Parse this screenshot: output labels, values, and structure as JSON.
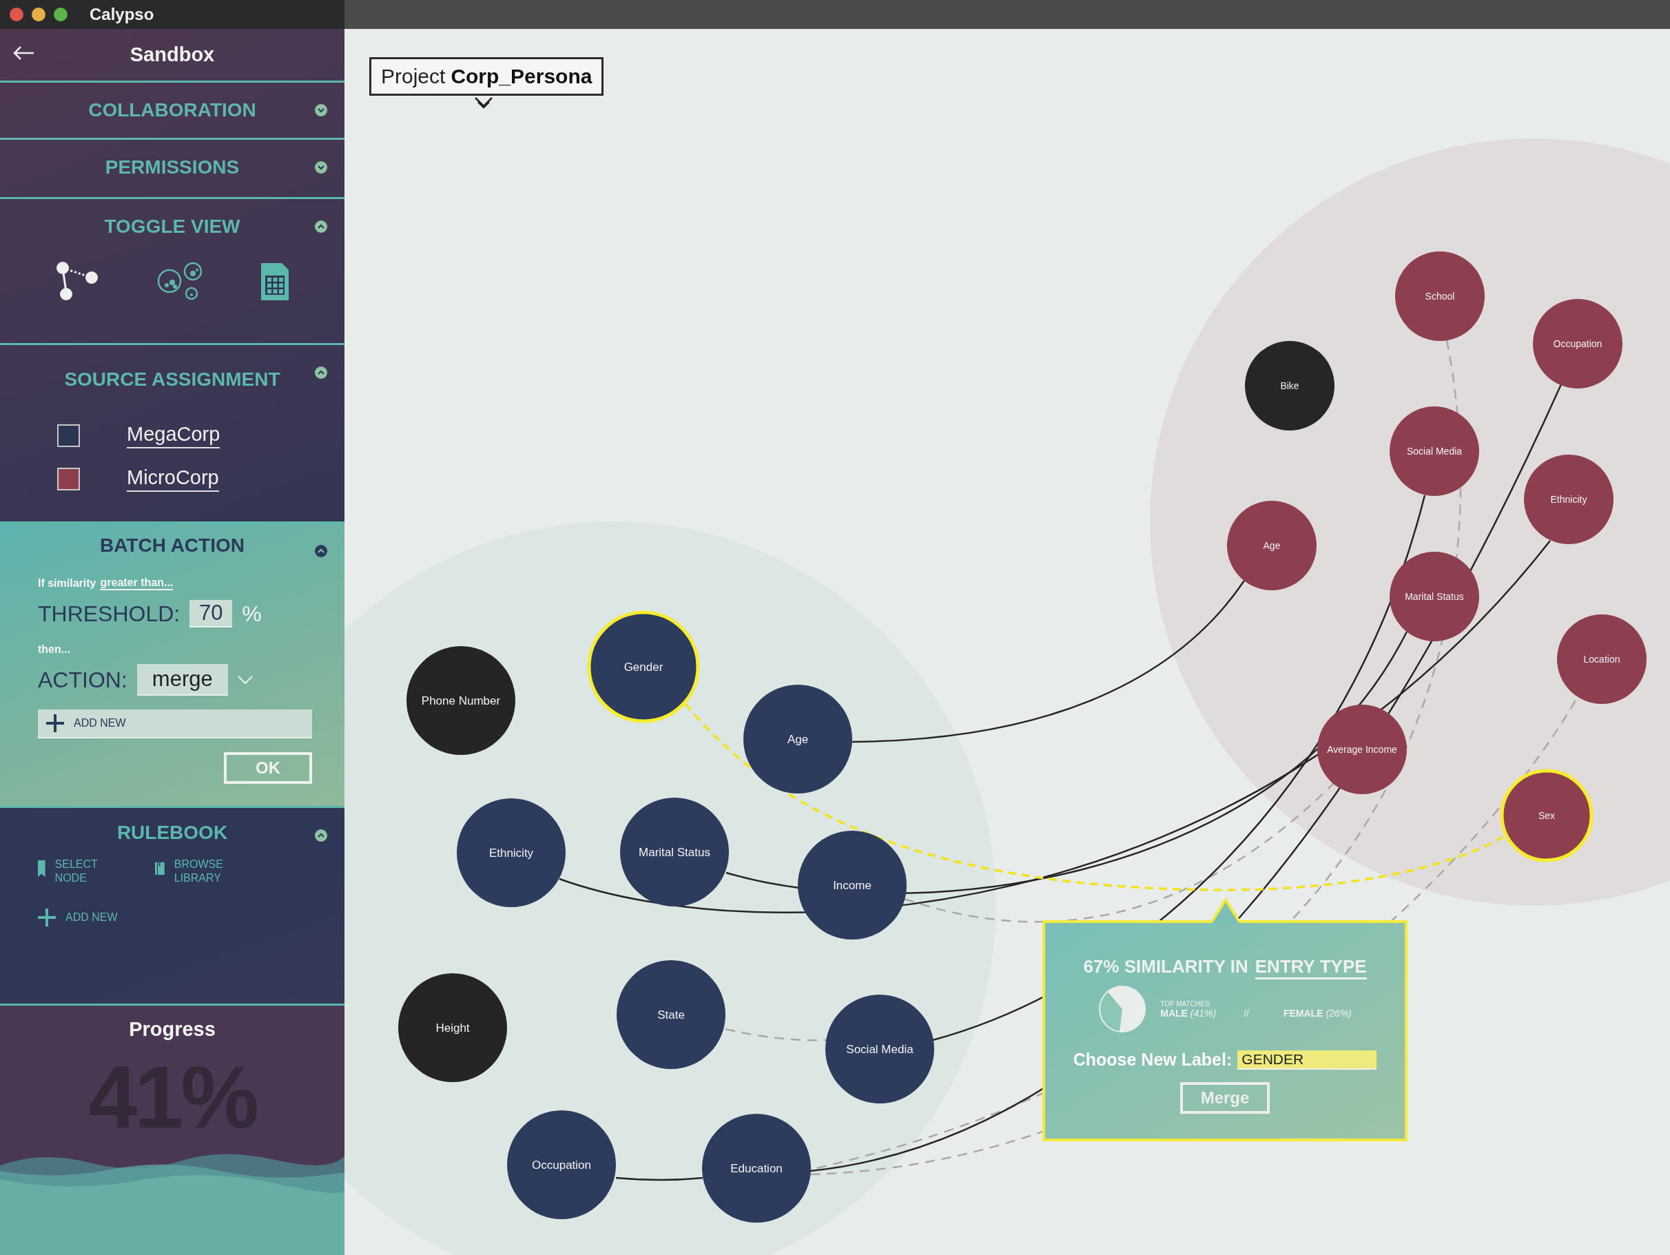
{
  "window": {
    "title": "Calypso"
  },
  "sidebar": {
    "title": "Sandbox",
    "collaboration": {
      "title": "COLLABORATION",
      "expanded": false
    },
    "permissions": {
      "title": "PERMISSIONS",
      "expanded": false
    },
    "toggle_view": {
      "title": "TOGGLE VIEW",
      "expanded": true,
      "views": [
        {
          "kind": "graph",
          "selected": true
        },
        {
          "kind": "clusters",
          "selected": false
        },
        {
          "kind": "table",
          "selected": false
        }
      ]
    },
    "source_assignment": {
      "title": "SOURCE ASSIGNMENT",
      "expanded": true,
      "sources": [
        {
          "label": "MegaCorp",
          "color": "#2c3552"
        },
        {
          "label": "MicroCorp",
          "color": "#8e3f4f"
        }
      ]
    },
    "batch_action": {
      "title": "BATCH ACTION",
      "expanded": true,
      "condition": "If similarity",
      "condition_link": "greater than...",
      "threshold_label": "THRESHOLD:",
      "threshold_value": "70",
      "threshold_unit": "%",
      "then": "then...",
      "action_label": "ACTION:",
      "action_value": "merge",
      "add_new": "ADD NEW",
      "ok": "OK"
    },
    "rulebook": {
      "title": "RULEBOOK",
      "expanded": true,
      "tools": [
        {
          "kind": "bookmark",
          "label": "SELECT NODE"
        },
        {
          "kind": "library",
          "label": "BROWSE LIBRARY"
        }
      ],
      "add_new": "ADD NEW"
    },
    "progress": {
      "title": "Progress",
      "value": "41%"
    }
  },
  "canvas": {
    "project_prefix": "Project",
    "project_name": "Corp_Persona",
    "left_nodes": [
      {
        "label": "Phone Number",
        "color": "#252525",
        "selected": false
      },
      {
        "label": "Gender",
        "color": "#2d3b5c",
        "selected": true
      },
      {
        "label": "Age",
        "color": "#2d3b5c",
        "selected": false
      },
      {
        "label": "Ethnicity",
        "color": "#2d3b5c",
        "selected": false
      },
      {
        "label": "Marital Status",
        "color": "#2d3b5c",
        "selected": false
      },
      {
        "label": "Income",
        "color": "#2d3b5c",
        "selected": false
      },
      {
        "label": "Height",
        "color": "#252525",
        "selected": false
      },
      {
        "label": "State",
        "color": "#2d3b5c",
        "selected": false
      },
      {
        "label": "Social Media",
        "color": "#2d3b5c",
        "selected": false
      },
      {
        "label": "Occupation",
        "color": "#2d3b5c",
        "selected": false
      },
      {
        "label": "Education",
        "color": "#2d3b5c",
        "selected": false
      }
    ],
    "right_nodes": [
      {
        "label": "School",
        "color": "#8e3f4f",
        "selected": false
      },
      {
        "label": "Occupation",
        "color": "#8e3f4f",
        "selected": false
      },
      {
        "label": "Bike",
        "color": "#262626",
        "selected": false
      },
      {
        "label": "Social Media",
        "color": "#8e3f4f",
        "selected": false
      },
      {
        "label": "Ethnicity",
        "color": "#8e3f4f",
        "selected": false
      },
      {
        "label": "Age",
        "color": "#8e3f4f",
        "selected": false
      },
      {
        "label": "Marital Status",
        "color": "#8e3f4f",
        "selected": false
      },
      {
        "label": "Location",
        "color": "#8e3f4f",
        "selected": false
      },
      {
        "label": "Average Income",
        "color": "#8e3f4f",
        "selected": false
      },
      {
        "label": "Sex",
        "color": "#8e3f4f",
        "selected": true
      }
    ],
    "popup": {
      "heading": "67% SIMILARITY IN",
      "heading_link": "ENTRY TYPE",
      "top_matches": "TOP MATCHES:",
      "match_1": "**MALE** *(41%)*",
      "separator": "//",
      "match_2": "**FEMALE** *(26%)*",
      "label_prompt": "Choose New Label:",
      "label_value": "GENDER",
      "merge": "Merge"
    }
  }
}
